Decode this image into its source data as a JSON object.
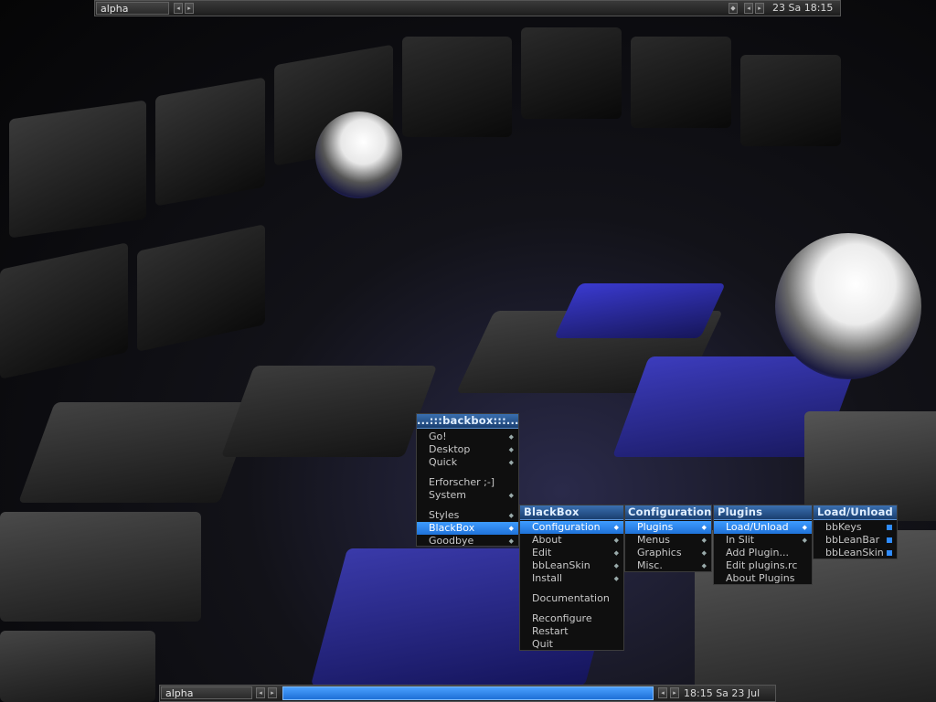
{
  "top_panel": {
    "workspace": "alpha",
    "clock": "23 Sa 18:15"
  },
  "bottom_panel": {
    "workspace": "alpha",
    "clock": "18:15 Sa 23 Jul"
  },
  "root_menu": {
    "title": "...:::backbox:::...",
    "items": [
      {
        "label": "Go!",
        "submenu": true
      },
      {
        "label": "Desktop",
        "submenu": true
      },
      {
        "label": "Quick",
        "submenu": true
      },
      {
        "separator": true
      },
      {
        "label": "Erforscher ;-]",
        "submenu": false
      },
      {
        "label": "System",
        "submenu": true
      },
      {
        "separator": true
      },
      {
        "label": "Styles",
        "submenu": true
      },
      {
        "label": "BlackBox",
        "submenu": true,
        "selected": true
      },
      {
        "label": "Goodbye",
        "submenu": true
      }
    ]
  },
  "blackbox_menu": {
    "title": "BlackBox",
    "items": [
      {
        "label": "Configuration",
        "submenu": true,
        "selected": true
      },
      {
        "label": "About",
        "submenu": true
      },
      {
        "label": "Edit",
        "submenu": true
      },
      {
        "label": "bbLeanSkin",
        "submenu": true
      },
      {
        "label": "Install",
        "submenu": true
      },
      {
        "separator": true
      },
      {
        "label": "Documentation",
        "submenu": false
      },
      {
        "separator": true
      },
      {
        "label": "Reconfigure",
        "submenu": false
      },
      {
        "label": "Restart",
        "submenu": false
      },
      {
        "label": "Quit",
        "submenu": false
      }
    ]
  },
  "configuration_menu": {
    "title": "Configuration",
    "items": [
      {
        "label": "Plugins",
        "submenu": true,
        "selected": true
      },
      {
        "label": "Menus",
        "submenu": true
      },
      {
        "label": "Graphics",
        "submenu": true
      },
      {
        "label": "Misc.",
        "submenu": true
      }
    ]
  },
  "plugins_menu": {
    "title": "Plugins",
    "items": [
      {
        "label": "Load/Unload",
        "submenu": true,
        "selected": true
      },
      {
        "label": "In Slit",
        "submenu": true
      },
      {
        "label": "Add Plugin...",
        "submenu": false
      },
      {
        "label": "Edit plugins.rc",
        "submenu": false
      },
      {
        "label": "About Plugins",
        "submenu": false
      }
    ]
  },
  "load_unload_menu": {
    "title": "Load/Unload",
    "items": [
      {
        "label": "bbKeys",
        "checked": true
      },
      {
        "label": "bbLeanBar",
        "checked": true
      },
      {
        "label": "bbLeanSkin",
        "checked": true
      }
    ]
  },
  "colors": {
    "accent": "#2f8cff",
    "menu_bg": "#0f0f0f",
    "wallpaper_floor": "#2a2a7a"
  }
}
